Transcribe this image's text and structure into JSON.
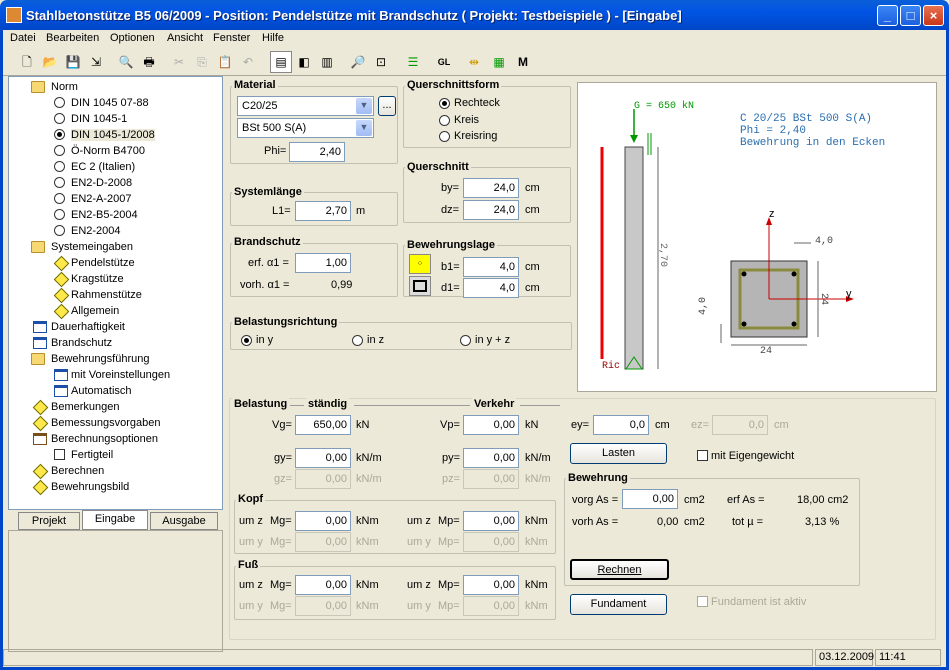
{
  "window": {
    "title": "Stahlbetonstütze B5 06/2009 - Position: Pendelstütze mit Brandschutz ( Projekt: Testbeispiele ) - [Eingabe]"
  },
  "menu": [
    "Datei",
    "Bearbeiten",
    "Optionen",
    "Ansicht",
    "Fenster",
    "Hilfe"
  ],
  "toolbar": {
    "gl": "GL",
    "m": "M"
  },
  "tree": {
    "norm": "Norm",
    "n1": "DIN 1045 07-88",
    "n2": "DIN 1045-1",
    "n3": "DIN 1045-1/2008",
    "n4": "Ö-Norm B4700",
    "n5": "EC 2 (Italien)",
    "n6": "EN2-D-2008",
    "n7": "EN2-A-2007",
    "n8": "EN2-B5-2004",
    "n9": "EN2-2004",
    "sys": "Systemeingaben",
    "s1": "Pendelstütze",
    "s2": "Kragstütze",
    "s3": "Rahmenstütze",
    "s4": "Allgemein",
    "dauer": "Dauerhaftigkeit",
    "brand": "Brandschutz",
    "bew": "Bewehrungsführung",
    "b1": "mit Voreinstellungen",
    "b2": "Automatisch",
    "bem": "Bemerkungen",
    "bemv": "Bemessungsvorgaben",
    "bo": "Berechnungsoptionen",
    "fertig": "Fertigteil",
    "rech": "Berechnen",
    "bild": "Bewehrungsbild"
  },
  "tabs": {
    "projekt": "Projekt",
    "eingabe": "Eingabe",
    "ausgabe": "Ausgabe"
  },
  "material": {
    "label": "Material",
    "concrete": "C20/25",
    "steel": "BSt 500 S(A)",
    "phi_label": "Phi=",
    "phi": "2,40",
    "more": "..."
  },
  "qform": {
    "label": "Querschnittsform",
    "r1": "Rechteck",
    "r2": "Kreis",
    "r3": "Kreisring"
  },
  "system": {
    "label": "Systemlänge",
    "l1": "L1=",
    "v": "2,70",
    "unit": "m"
  },
  "qs": {
    "label": "Querschnitt",
    "by": "by=",
    "byv": "24,0",
    "dz": "dz=",
    "dzv": "24,0",
    "unit": "cm"
  },
  "brand": {
    "label": "Brandschutz",
    "erf": "erf. α1 =",
    "erfv": "1,00",
    "vorh": "vorh. α1 =",
    "vorhv": "0,99"
  },
  "bl": {
    "label": "Bewehrungslage",
    "b1": "b1=",
    "b1v": "4,0",
    "d1": "d1=",
    "d1v": "4,0",
    "unit": "cm"
  },
  "richt": {
    "label": "Belastungsrichtung",
    "r1": "in y",
    "r2": "in z",
    "r3": "in y + z"
  },
  "belastung": {
    "label": "Belastung",
    "st": "ständig",
    "vk": "Verkehr",
    "vg": "Vg=",
    "vgv": "650,00",
    "kn": "kN",
    "vp": "Vp=",
    "vpv": "0,00",
    "ey": "ey=",
    "eyv": "0,0",
    "cm": "cm",
    "ez": "ez=",
    "ezv": "0,0",
    "gy": "gy=",
    "gyv": "0,00",
    "knm": "kN/m",
    "py": "py=",
    "pyv": "0,00",
    "gz": "gz=",
    "gzv": "0,00",
    "pz": "pz=",
    "pzv": "0,00",
    "lasten": "Lasten",
    "eigen": "mit Eigengewicht"
  },
  "kopf": {
    "label": "Kopf",
    "umz": "um z",
    "umy": "um y",
    "mg": "Mg=",
    "mp": "Mp=",
    "v1": "0,00",
    "v2": "0,00",
    "v3": "0,00",
    "v4": "0,00",
    "unit": "kNm"
  },
  "fuss": {
    "label": "Fuß",
    "umz": "um z",
    "umy": "um y",
    "mg": "Mg=",
    "mp": "Mp=",
    "v1": "0,00",
    "v2": "0,00",
    "v3": "0,00",
    "v4": "0,00",
    "unit": "kNm"
  },
  "bewehrung": {
    "label": "Bewehrung",
    "vorg": "vorg As =",
    "vorgv": "0,00",
    "cm2": "cm2",
    "erf": "erf As =",
    "erfv": "18,00 cm2",
    "vorh": "vorh As =",
    "vorhv": "0,00",
    "cm2b": "cm2",
    "tot": "tot µ =",
    "totv": "3,13 %",
    "rechnen": "Rechnen"
  },
  "fund": {
    "btn": "Fundament",
    "chk": "Fundament ist aktiv"
  },
  "drawing": {
    "g": "G = 650 kN",
    "l1": "C 20/25  BSt 500 S(A)",
    "l2": "Phi = 2,40",
    "l3": "Bewehrung in den Ecken",
    "len": "2,70",
    "z": "z",
    "y": "y",
    "d40a": "4,0",
    "d40b": "4,0",
    "d24a": "24",
    "d24b": "24",
    "ric": "Ric"
  },
  "status": {
    "date": "03.12.2009",
    "time": "11:41"
  }
}
